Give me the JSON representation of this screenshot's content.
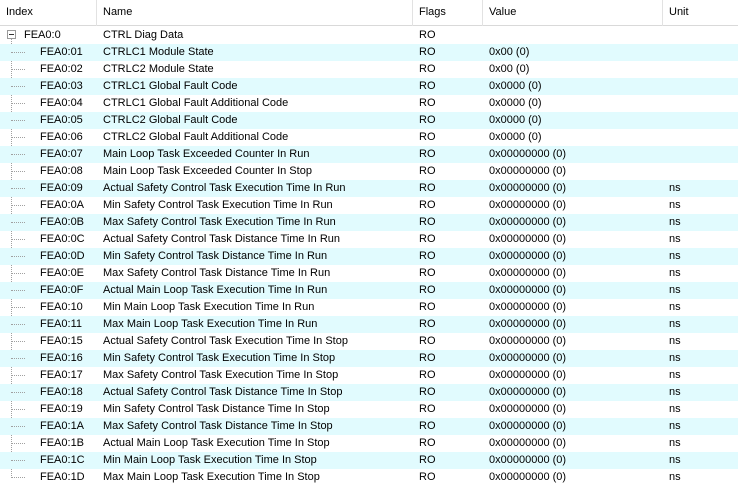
{
  "columns": {
    "index": "Index",
    "name": "Name",
    "flags": "Flags",
    "value": "Value",
    "unit": "Unit"
  },
  "rows": [
    {
      "index": "FEA0:0",
      "name": "CTRL Diag Data",
      "flags": "RO",
      "value": "",
      "unit": ""
    },
    {
      "index": "FEA0:01",
      "name": "CTRLC1 Module State",
      "flags": "RO",
      "value": "0x00 (0)",
      "unit": ""
    },
    {
      "index": "FEA0:02",
      "name": "CTRLC2 Module State",
      "flags": "RO",
      "value": "0x00 (0)",
      "unit": ""
    },
    {
      "index": "FEA0:03",
      "name": "CTRLC1 Global Fault Code",
      "flags": "RO",
      "value": "0x0000 (0)",
      "unit": ""
    },
    {
      "index": "FEA0:04",
      "name": "CTRLC1 Global Fault Additional Code",
      "flags": "RO",
      "value": "0x0000 (0)",
      "unit": ""
    },
    {
      "index": "FEA0:05",
      "name": "CTRLC2 Global Fault Code",
      "flags": "RO",
      "value": "0x0000 (0)",
      "unit": ""
    },
    {
      "index": "FEA0:06",
      "name": "CTRLC2 Global Fault Additional Code",
      "flags": "RO",
      "value": "0x0000 (0)",
      "unit": ""
    },
    {
      "index": "FEA0:07",
      "name": "Main Loop Task Exceeded Counter In Run",
      "flags": "RO",
      "value": "0x00000000 (0)",
      "unit": ""
    },
    {
      "index": "FEA0:08",
      "name": "Main Loop Task Exceeded Counter In Stop",
      "flags": "RO",
      "value": "0x00000000 (0)",
      "unit": ""
    },
    {
      "index": "FEA0:09",
      "name": "Actual Safety Control Task Execution Time In Run",
      "flags": "RO",
      "value": "0x00000000 (0)",
      "unit": "ns"
    },
    {
      "index": "FEA0:0A",
      "name": "Min Safety Control Task Execution Time In Run",
      "flags": "RO",
      "value": "0x00000000 (0)",
      "unit": "ns"
    },
    {
      "index": "FEA0:0B",
      "name": "Max Safety Control Task Execution Time In Run",
      "flags": "RO",
      "value": "0x00000000 (0)",
      "unit": "ns"
    },
    {
      "index": "FEA0:0C",
      "name": "Actual Safety Control Task Distance Time In Run",
      "flags": "RO",
      "value": "0x00000000 (0)",
      "unit": "ns"
    },
    {
      "index": "FEA0:0D",
      "name": "Min Safety Control Task Distance Time In Run",
      "flags": "RO",
      "value": "0x00000000 (0)",
      "unit": "ns"
    },
    {
      "index": "FEA0:0E",
      "name": "Max Safety Control Task Distance Time In Run",
      "flags": "RO",
      "value": "0x00000000 (0)",
      "unit": "ns"
    },
    {
      "index": "FEA0:0F",
      "name": "Actual Main Loop Task Execution Time In Run",
      "flags": "RO",
      "value": "0x00000000 (0)",
      "unit": "ns"
    },
    {
      "index": "FEA0:10",
      "name": "Min Main Loop Task Execution Time In Run",
      "flags": "RO",
      "value": "0x00000000 (0)",
      "unit": "ns"
    },
    {
      "index": "FEA0:11",
      "name": "Max Main Loop Task Execution Time In Run",
      "flags": "RO",
      "value": "0x00000000 (0)",
      "unit": "ns"
    },
    {
      "index": "FEA0:15",
      "name": "Actual Safety Control Task Execution Time In Stop",
      "flags": "RO",
      "value": "0x00000000 (0)",
      "unit": "ns"
    },
    {
      "index": "FEA0:16",
      "name": "Min Safety Control Task Execution Time In Stop",
      "flags": "RO",
      "value": "0x00000000 (0)",
      "unit": "ns"
    },
    {
      "index": "FEA0:17",
      "name": "Max Safety Control Task Execution Time In Stop",
      "flags": "RO",
      "value": "0x00000000 (0)",
      "unit": "ns"
    },
    {
      "index": "FEA0:18",
      "name": "Actual Safety Control Task Distance Time In Stop",
      "flags": "RO",
      "value": "0x00000000 (0)",
      "unit": "ns"
    },
    {
      "index": "FEA0:19",
      "name": "Min Safety Control Task Distance Time In Stop",
      "flags": "RO",
      "value": "0x00000000 (0)",
      "unit": "ns"
    },
    {
      "index": "FEA0:1A",
      "name": "Max Safety Control Task Distance Time In Stop",
      "flags": "RO",
      "value": "0x00000000 (0)",
      "unit": "ns"
    },
    {
      "index": "FEA0:1B",
      "name": "Actual Main Loop Task Execution Time In Stop",
      "flags": "RO",
      "value": "0x00000000 (0)",
      "unit": "ns"
    },
    {
      "index": "FEA0:1C",
      "name": "Min Main Loop Task Execution Time In Stop",
      "flags": "RO",
      "value": "0x00000000 (0)",
      "unit": "ns"
    },
    {
      "index": "FEA0:1D",
      "name": "Max Main Loop Task Execution Time In Stop",
      "flags": "RO",
      "value": "0x00000000 (0)",
      "unit": "ns"
    }
  ],
  "colors": {
    "alt_row": "#e1fbfe",
    "grid_line": "#e2e2e2",
    "tree_line": "#a0a0a0"
  }
}
